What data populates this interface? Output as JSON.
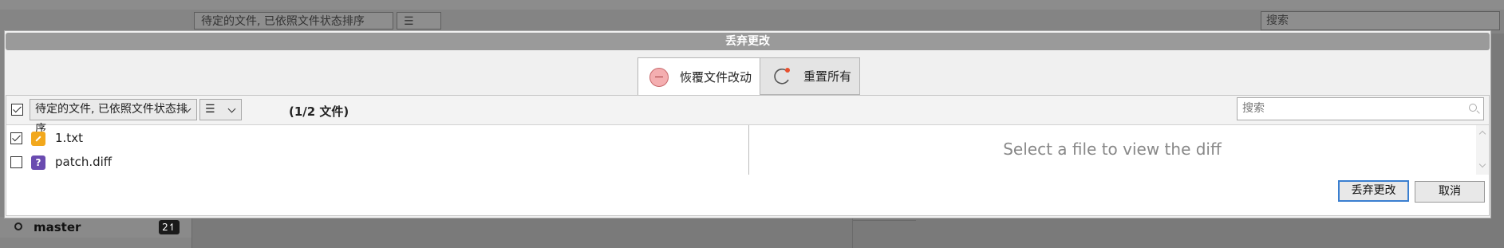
{
  "background": {
    "view_combo": "待定的文件, 已依照文件状态排序",
    "view_combo2": "☰",
    "search_placeholder": "搜索",
    "branch": {
      "name": "master",
      "badge": "2↿"
    }
  },
  "dialog": {
    "title": "丢弃更改",
    "tabs": [
      {
        "label": "恢覆文件改动",
        "icon": "discard-icon",
        "active": true
      },
      {
        "label": "重置所有",
        "icon": "reset-icon",
        "active": false
      }
    ],
    "toolbar": {
      "sort_combo": "待定的文件, 已依照文件状态排序",
      "view_combo": "☰",
      "file_count": "(1/2 文件)",
      "search_placeholder": "搜索"
    },
    "files": [
      {
        "name": "1.txt",
        "checked": true,
        "status": "modified",
        "icon": "pencil-icon"
      },
      {
        "name": "patch.diff",
        "checked": false,
        "status": "unknown",
        "icon": "?"
      }
    ],
    "diff_placeholder": "Select a file to view the diff",
    "buttons": {
      "confirm": "丢弃更改",
      "cancel": "取消"
    }
  },
  "colors": {
    "accent": "#3a7fd0",
    "modified": "#f2a81d",
    "untracked": "#6a4bb0",
    "discard_icon": "#f4aeb0",
    "reset_dot": "#e8502f"
  }
}
